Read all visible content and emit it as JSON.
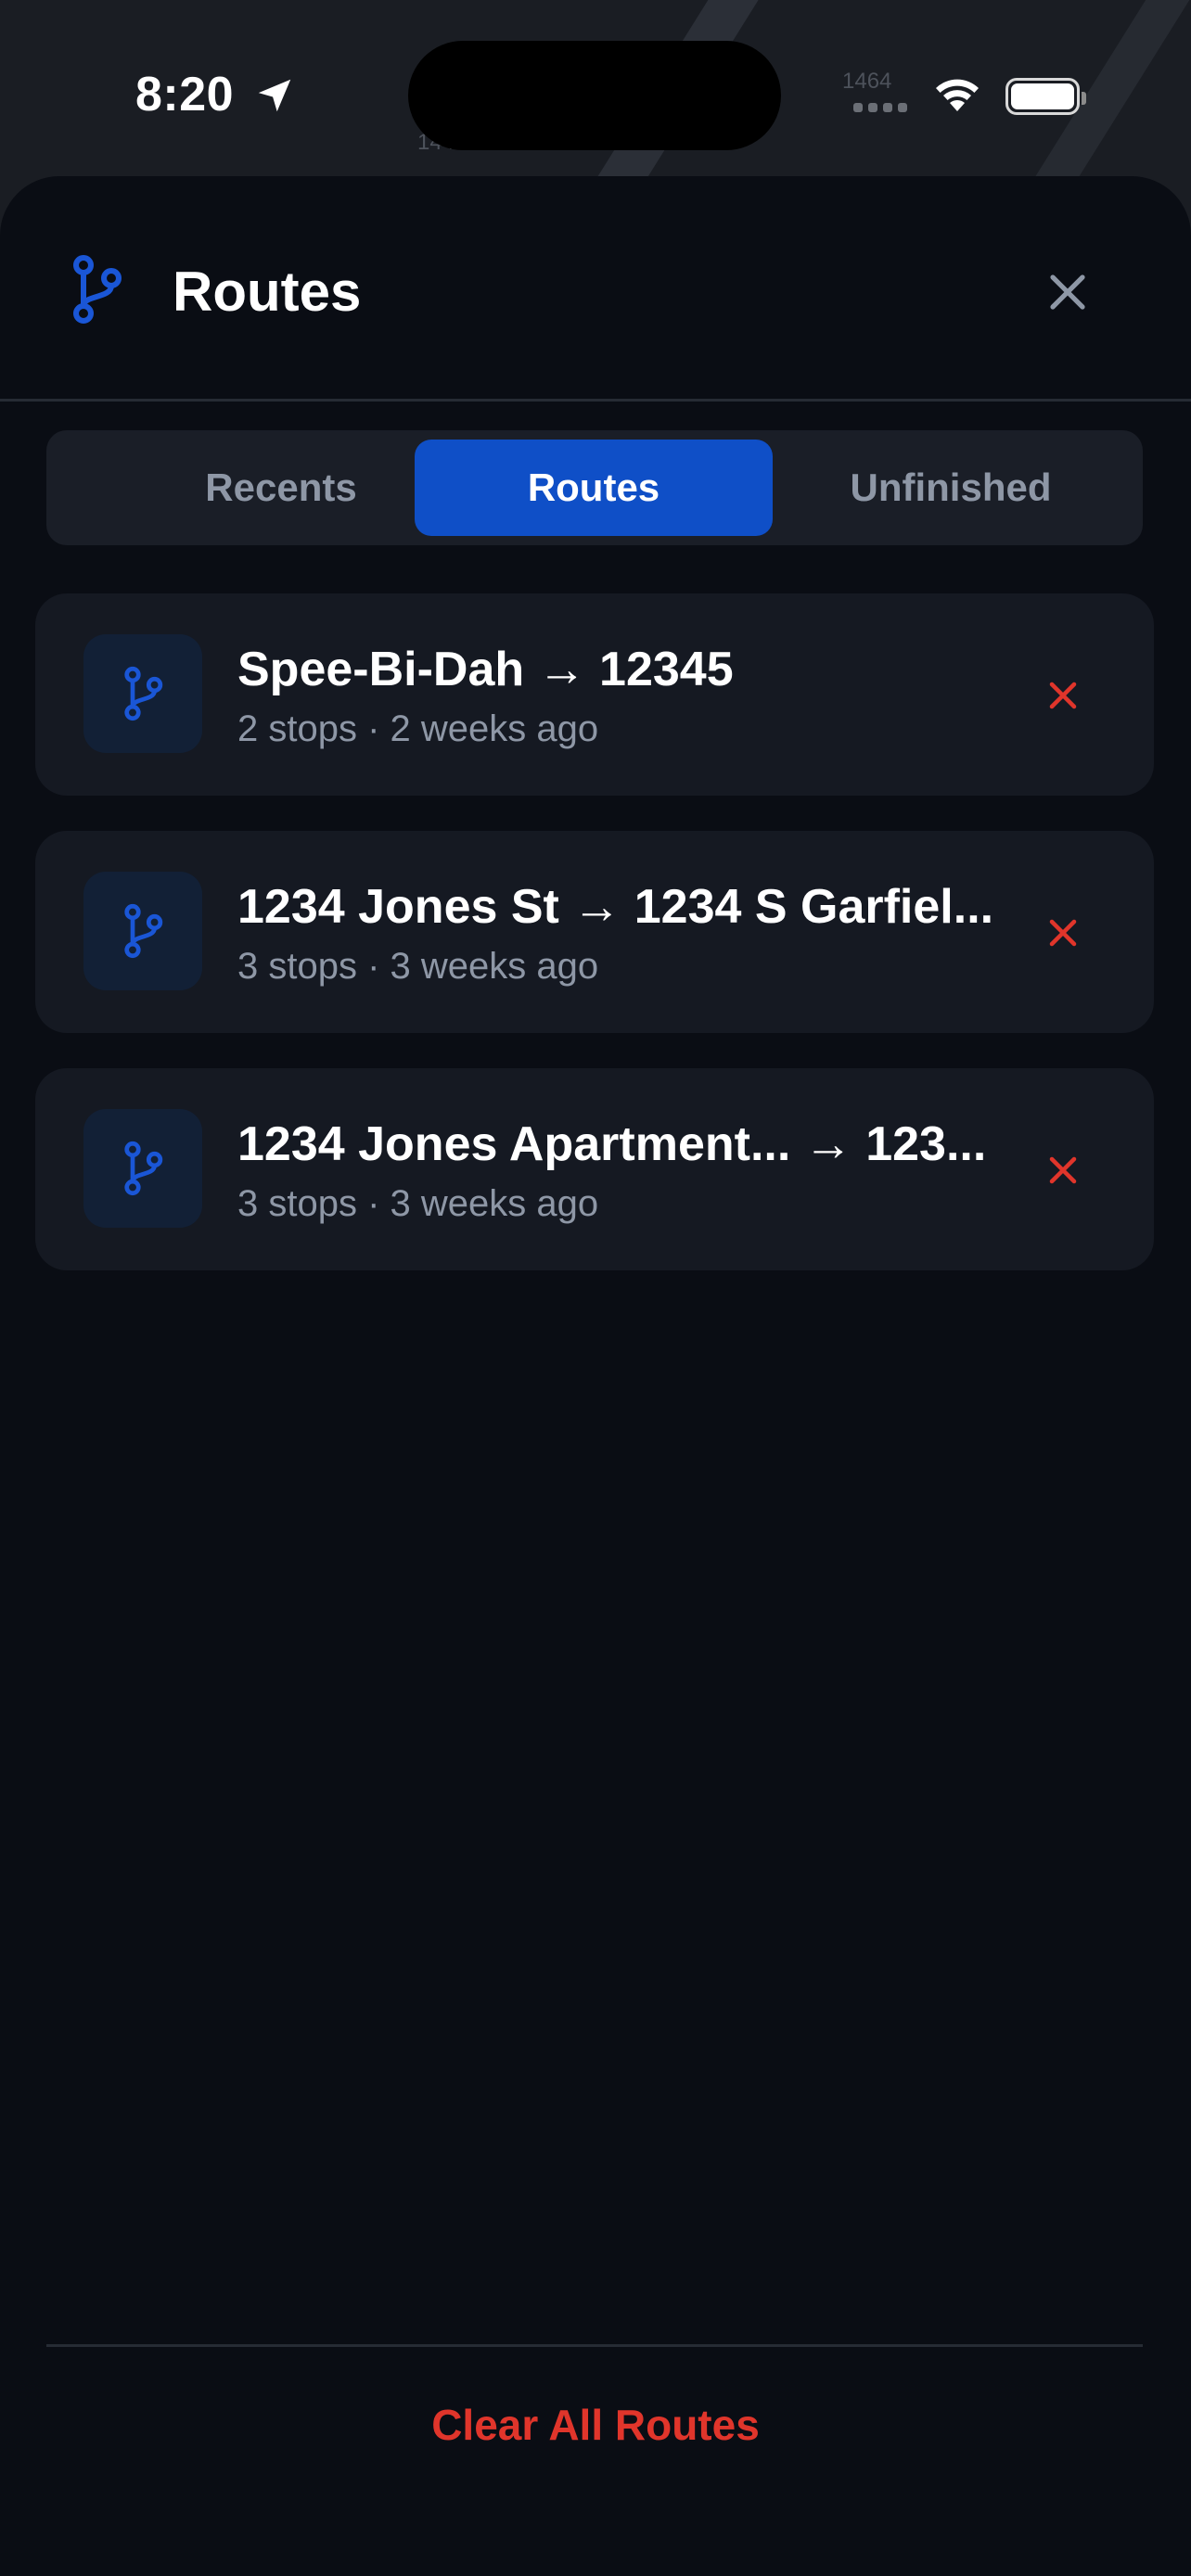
{
  "colors": {
    "accent": "#0f4fc7",
    "delete": "#e0352b",
    "background": "#0a0d14",
    "card": "#151922",
    "muted_text": "#8e97a6"
  },
  "map": {
    "labels": [
      "1464",
      "1445"
    ]
  },
  "status_bar": {
    "time": "8:20",
    "location_icon": "location-arrow-icon",
    "signal_icon": "cellular-signal-icon",
    "wifi_icon": "wifi-icon",
    "battery_icon": "battery-full-icon"
  },
  "sheet": {
    "header_icon": "route-branch-icon",
    "title": "Routes",
    "close_icon": "close-icon"
  },
  "tabs": [
    {
      "label": "Recents",
      "selected": false
    },
    {
      "label": "Routes",
      "selected": true
    },
    {
      "label": "Unfinished",
      "selected": false
    }
  ],
  "routes": [
    {
      "title": "Spee-Bi-Dah → 12345",
      "subtitle": "2 stops · 2 weeks ago",
      "icon": "route-branch-icon",
      "delete_icon": "close-icon"
    },
    {
      "title": "1234 Jones St → 1234 S Garfiel...",
      "subtitle": "3 stops · 3 weeks ago",
      "icon": "route-branch-icon",
      "delete_icon": "close-icon"
    },
    {
      "title": "1234 Jones Apartment... → 123...",
      "subtitle": "3 stops · 3 weeks ago",
      "icon": "route-branch-icon",
      "delete_icon": "close-icon"
    }
  ],
  "footer": {
    "clear_label": "Clear All Routes"
  }
}
